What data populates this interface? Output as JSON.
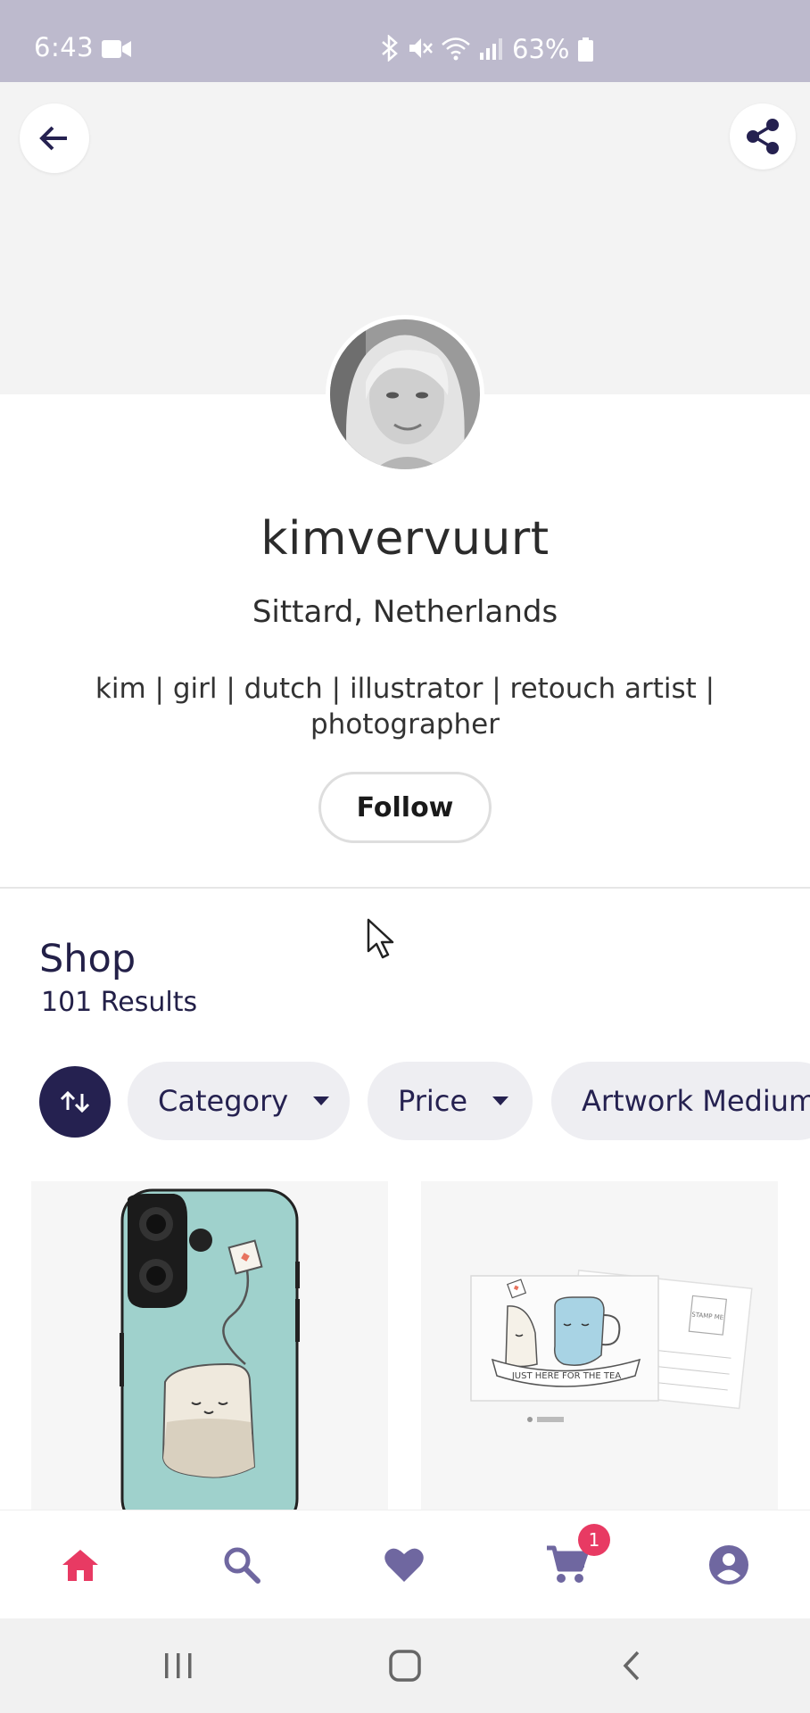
{
  "status_bar": {
    "time": "6:43",
    "battery": "63%"
  },
  "header": {
    "back_icon": "arrow-left-icon",
    "share_icon": "share-icon"
  },
  "profile": {
    "username": "kimvervuurt",
    "location": "Sittard, Netherlands",
    "bio": "kim | girl | dutch | illustrator | retouch artist | photographer",
    "follow_label": "Follow"
  },
  "shop": {
    "title": "Shop",
    "results": "101 Results"
  },
  "filters": {
    "sort_icon": "sort-arrows-icon",
    "chips": [
      {
        "label": "Category"
      },
      {
        "label": "Price"
      },
      {
        "label": "Artwork Medium"
      }
    ]
  },
  "products": [
    {
      "type": "phone case",
      "image": "tea-bag-phone-case"
    },
    {
      "type": "postcard",
      "image": "just-here-for-the-tea-postcard",
      "art_text": "JUST HERE FOR THE TEA",
      "stamp_text": "STAMP ME"
    }
  ],
  "bottom_nav": {
    "items": [
      {
        "icon": "home-icon",
        "active": true
      },
      {
        "icon": "search-icon"
      },
      {
        "icon": "heart-icon"
      },
      {
        "icon": "cart-icon"
      },
      {
        "icon": "account-icon"
      }
    ],
    "cart_count": "1"
  },
  "colors": {
    "status_bar": "#bdbacd",
    "navy": "#252150",
    "active": "#e83a63",
    "nav_icon": "#6f67a0",
    "chip_bg": "#eeeef2"
  }
}
